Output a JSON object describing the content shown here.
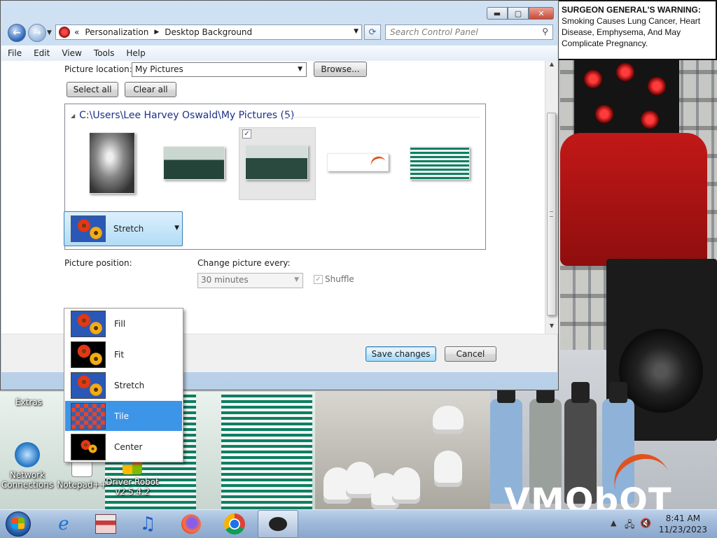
{
  "window": {
    "title_buttons": [
      "minimize",
      "maximize",
      "close"
    ],
    "nav": {
      "back": "back-arrow",
      "forward": "forward-arrow"
    },
    "breadcrumb": [
      "Personalization",
      "Desktop Background"
    ],
    "breadcrumb_prefix": "«",
    "search_placeholder": "Search Control Panel",
    "menu": [
      "File",
      "Edit",
      "View",
      "Tools",
      "Help"
    ]
  },
  "picture_location": {
    "label": "Picture location:",
    "value": "My Pictures",
    "browse_label": "Browse...",
    "select_all_label": "Select all",
    "clear_all_label": "Clear all"
  },
  "gallery": {
    "group_header": "C:\\Users\\Lee Harvey Oswald\\My Pictures (5)",
    "items": [
      {
        "name": "portrait-photo",
        "checked": false
      },
      {
        "name": "skibidi-scene-1",
        "checked": false
      },
      {
        "name": "skibidi-scene-2",
        "checked": true
      },
      {
        "name": "swoosh-logo",
        "checked": false
      },
      {
        "name": "newport-packs",
        "checked": false
      }
    ]
  },
  "position": {
    "label": "Picture position:",
    "current": "Stretch",
    "options": [
      "Fill",
      "Fit",
      "Stretch",
      "Tile",
      "Center"
    ],
    "highlighted": "Tile"
  },
  "slideshow": {
    "label": "Change picture every:",
    "interval": "30 minutes",
    "shuffle_label": "Shuffle",
    "shuffle_checked": true
  },
  "footer": {
    "save_label": "Save changes",
    "cancel_label": "Cancel"
  },
  "desktop": {
    "warning_title": "SURGEON GENERAL'S WARNING:",
    "warning_text": "Smoking Causes Lung Cancer, Heart Disease, Emphysema, And May Complicate Pregnancy.",
    "wallpaper_text": "VMObOT",
    "icons": [
      {
        "label": "Extras"
      },
      {
        "label": "Network\nConnections"
      },
      {
        "label": "Notepad++"
      },
      {
        "label": "Driver Robot\nv2.5.4.2"
      }
    ]
  },
  "taskbar": {
    "apps": [
      "internet-explorer",
      "app-store",
      "itunes",
      "firefox",
      "chrome",
      "painter"
    ],
    "time": "8:41 AM",
    "date": "11/23/2023"
  },
  "colors": {
    "selection_blue": "#3d95e8",
    "link_blue": "#1e3287",
    "close_red": "#c94a36"
  }
}
